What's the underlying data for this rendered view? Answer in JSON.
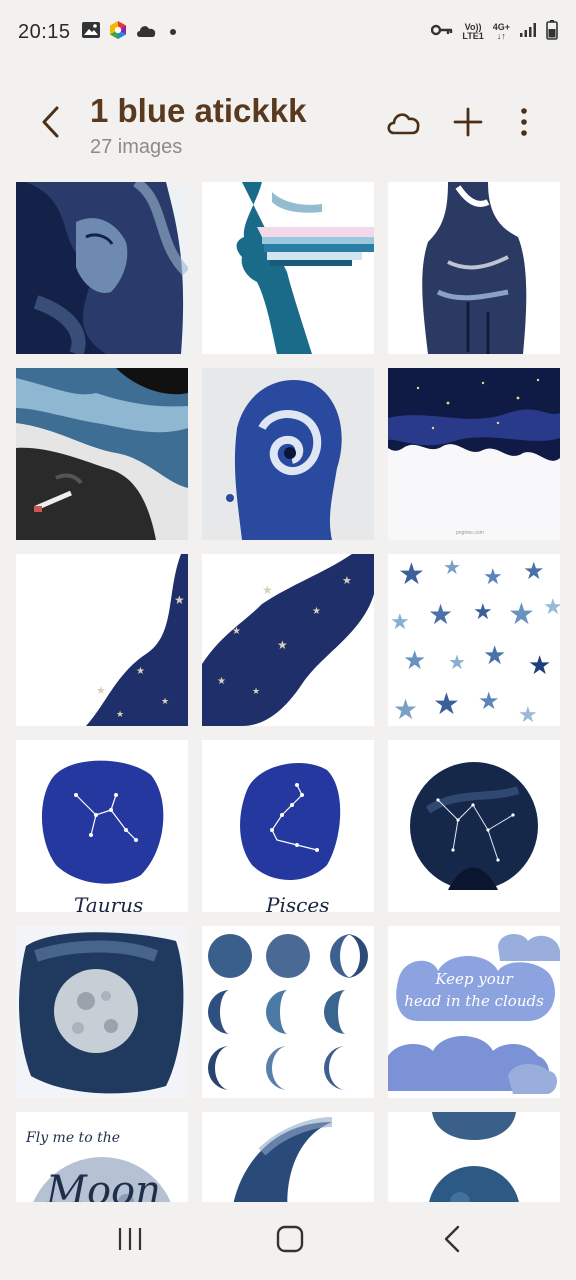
{
  "status_bar": {
    "time": "20:15",
    "left_icons": [
      "gallery-notification-icon",
      "color-app-icon",
      "cloud-icon",
      "dot-icon"
    ],
    "network_line1": "Vo))",
    "network_line2": "LTE1",
    "network_type": "4G+",
    "right_icons": [
      "vpn-key-icon",
      "signal-icon",
      "battery-icon"
    ]
  },
  "header": {
    "back_icon": "back-arrow-icon",
    "title": "1 blue atickkk",
    "subtitle": "27 images",
    "actions": [
      "cloud-sync-icon",
      "add-icon",
      "more-options-icon"
    ]
  },
  "thumbnail_texts": {
    "taurus": "Taurus",
    "pisces": "Pisces",
    "clouds_line1": "Keep your",
    "clouds_line2": "head in the clouds",
    "moon_line1": "Fly me to the",
    "moon_line2": "Moon",
    "watermark": "pngtree.com"
  },
  "colors": {
    "background": "#f3f1ef",
    "title": "#5a3a1e",
    "subtitle": "#8f8a86",
    "icon": "#4a3018",
    "navy": "#1f2f6b"
  },
  "nav_bar": {
    "icons": [
      "recent-apps-icon",
      "home-icon",
      "back-icon"
    ]
  }
}
